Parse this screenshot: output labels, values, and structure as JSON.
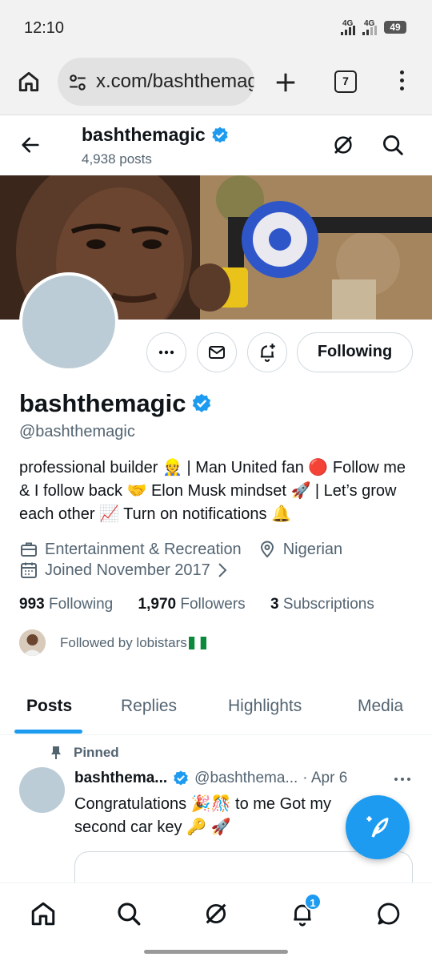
{
  "status_bar": {
    "time": "12:10",
    "network_1": "4G",
    "network_2": "4G",
    "battery": "49"
  },
  "browser": {
    "url": "x.com/bashthemagic",
    "tab_count": "7"
  },
  "header": {
    "name": "bashthemagic",
    "post_count": "4,938 posts"
  },
  "profile": {
    "name": "bashthemagic",
    "handle": "@bashthemagic",
    "follow_button": "Following",
    "bio": "professional builder 👷 | Man United fan 🔴 Follow me & I follow back 🤝 Elon Musk mindset 🚀 | Let’s grow each other 📈 Turn on notifications 🔔",
    "category": "Entertainment & Recreation",
    "location": "Nigerian",
    "joined": "Joined November 2017",
    "following_count": "993",
    "following_label": "Following",
    "followers_count": "1,970",
    "followers_label": "Followers",
    "subscriptions_count": "3",
    "subscriptions_label": "Subscriptions",
    "followed_by": "Followed by lobistars"
  },
  "tabs": [
    {
      "label": "Posts",
      "active": true
    },
    {
      "label": "Replies"
    },
    {
      "label": "Highlights"
    },
    {
      "label": "Media"
    }
  ],
  "pinned_post": {
    "pinned_label": "Pinned",
    "author_name": "bashthema...",
    "author_handle": "@bashthema...",
    "date": "· Apr 6",
    "text": "Congratulations 🎉🎊 to me Got my second car key 🔑 🚀"
  },
  "bottom_nav": {
    "notification_badge": "1"
  },
  "colors": {
    "accent": "#1d9bf0",
    "text": "#0f1419",
    "muted": "#536471",
    "border": "#cfd9de",
    "avatar_placeholder": "#bcccd6"
  }
}
